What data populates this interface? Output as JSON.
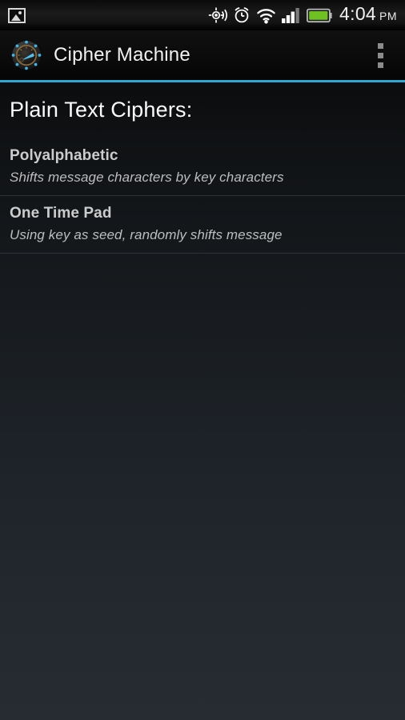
{
  "status_bar": {
    "notification_icon": "image-icon",
    "icons": [
      "gps-icon",
      "alarm-clock-icon",
      "wifi-icon",
      "signal-bars-icon",
      "battery-icon"
    ],
    "time": "4:04",
    "am_pm": "PM",
    "battery_color": "#6ec120",
    "signal_bars_filled": 3,
    "signal_bars_total": 4
  },
  "action_bar": {
    "app_icon": "cipher-dial-icon",
    "title": "Cipher Machine",
    "overflow_label": "More options",
    "accent_color": "#2ca8d2"
  },
  "content": {
    "heading": "Plain Text Ciphers:",
    "ciphers": [
      {
        "title": "Polyalphabetic",
        "subtitle": "Shifts message characters by key characters"
      },
      {
        "title": "One Time Pad",
        "subtitle": "Using key as seed, randomly shifts message"
      }
    ]
  }
}
